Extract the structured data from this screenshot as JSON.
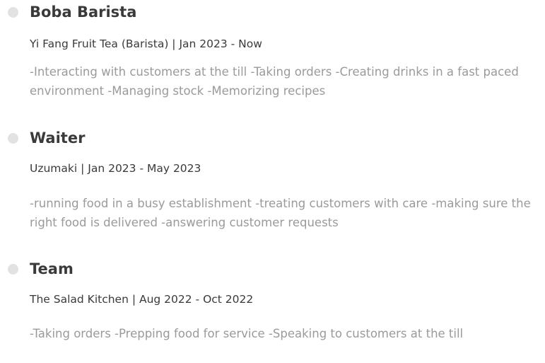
{
  "experience": [
    {
      "title": "Boba Barista",
      "meta": "Yi Fang Fruit Tea (Barista) | Jan 2023 - Now",
      "description": "-Interacting with customers at the till -Taking orders -Creating drinks in a fast paced environment -Managing stock -Memorizing recipes"
    },
    {
      "title": "Waiter",
      "meta": "Uzumaki | Jan 2023 - May 2023",
      "description": "-running food in a busy establishment -treating customers with care -making sure the right food is delivered -answering customer requests"
    },
    {
      "title": "Team",
      "meta": "The Salad Kitchen | Aug 2022 - Oct 2022",
      "description": "-Taking orders -Prepping food for service -Speaking to customers at the till"
    }
  ],
  "colors": {
    "title": "#3a3a3a",
    "meta": "#3a3a3a",
    "description": "#9a9a9a",
    "bullet": "#e2e2e2"
  }
}
